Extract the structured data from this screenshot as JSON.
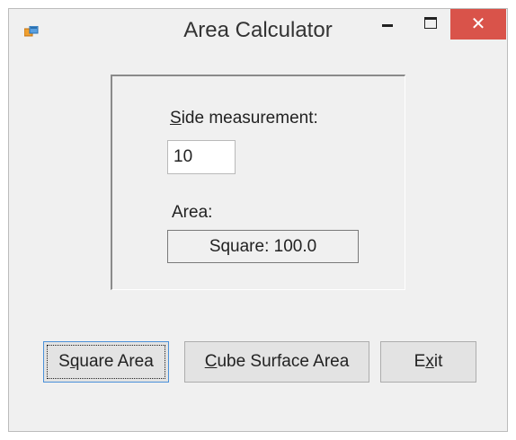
{
  "window": {
    "title": "Area Calculator",
    "icon": "app-window-icon",
    "controls": {
      "minimize": "minimize-icon",
      "maximize": "maximize-icon",
      "close": "close-icon"
    },
    "close_color": "#d9534a"
  },
  "form": {
    "side_label": {
      "mnemonic": "S",
      "rest": "ide measurement:"
    },
    "side_value": "10",
    "area_label": "Area:",
    "area_result": "Square: 100.0"
  },
  "buttons": {
    "square": {
      "pre": "S",
      "mnemonic": "q",
      "post": "uare Area"
    },
    "cube": {
      "pre": "",
      "mnemonic": "C",
      "post": "ube Surface Area"
    },
    "exit": {
      "pre": "E",
      "mnemonic": "x",
      "post": "it"
    }
  }
}
